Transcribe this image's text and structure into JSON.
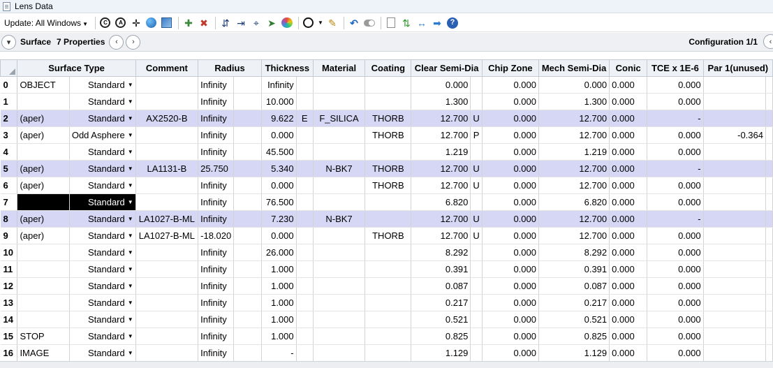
{
  "window": {
    "title": "Lens Data"
  },
  "toolbar": {
    "update_label": "Update: All Windows",
    "icons": [
      "recalc-icon",
      "autofocus-icon",
      "move-icon",
      "globe-icon",
      "tile-icon",
      "insert-surface-icon",
      "delete-surface-icon",
      "pickup-icon",
      "solve-icon",
      "tilt-icon",
      "fold-icon",
      "palette-icon",
      "aperture-ring-icon",
      "edit-icon",
      "undo-icon",
      "toggle-icon",
      "page-icon",
      "swap-icon",
      "expand-icon",
      "arrow-right-icon",
      "help-icon"
    ]
  },
  "surface_bar": {
    "label": "Surface",
    "properties": "7 Properties",
    "configuration": "Configuration 1/1"
  },
  "table": {
    "columns": [
      "Surface Type",
      "Comment",
      "Radius",
      "Thickness",
      "Material",
      "Coating",
      "Clear Semi-Dia",
      "Chip Zone",
      "Mech Semi-Dia",
      "Conic",
      "TCE x 1E-6",
      "Par 1(unused)"
    ],
    "rows": [
      {
        "num": "0",
        "name": "OBJECT",
        "type": "Standard",
        "comment": "",
        "radius": "Infinity",
        "rsolve": "",
        "thickness": "Infinity",
        "tsolve": "",
        "material": "",
        "coating": "",
        "clear": "0.000",
        "csolve": "",
        "chip": "0.000",
        "mech": "0.000",
        "conic": "0.000",
        "tce": "0.000",
        "par1": "",
        "hl": false,
        "black": false
      },
      {
        "num": "1",
        "name": "",
        "type": "Standard",
        "comment": "",
        "radius": "Infinity",
        "rsolve": "",
        "thickness": "10.000",
        "tsolve": "",
        "material": "",
        "coating": "",
        "clear": "1.300",
        "csolve": "",
        "chip": "0.000",
        "mech": "1.300",
        "conic": "0.000",
        "tce": "0.000",
        "par1": "",
        "hl": false,
        "black": false
      },
      {
        "num": "2",
        "name": "(aper)",
        "type": "Standard",
        "comment": "AX2520-B",
        "radius": "Infinity",
        "rsolve": "",
        "thickness": "9.622",
        "tsolve": "E",
        "material": "F_SILICA",
        "coating": "THORB",
        "clear": "12.700",
        "csolve": "U",
        "chip": "0.000",
        "mech": "12.700",
        "conic": "0.000",
        "tce": "-",
        "par1": "",
        "hl": true,
        "black": false
      },
      {
        "num": "3",
        "name": "(aper)",
        "type": "Odd Asphere",
        "comment": "",
        "radius": "Infinity",
        "rsolve": "",
        "thickness": "0.000",
        "tsolve": "",
        "material": "",
        "coating": "THORB",
        "clear": "12.700",
        "csolve": "P",
        "chip": "0.000",
        "mech": "12.700",
        "conic": "0.000",
        "tce": "0.000",
        "par1": "-0.364",
        "hl": false,
        "black": false
      },
      {
        "num": "4",
        "name": "",
        "type": "Standard",
        "comment": "",
        "radius": "Infinity",
        "rsolve": "",
        "thickness": "45.500",
        "tsolve": "",
        "material": "",
        "coating": "",
        "clear": "1.219",
        "csolve": "",
        "chip": "0.000",
        "mech": "1.219",
        "conic": "0.000",
        "tce": "0.000",
        "par1": "",
        "hl": false,
        "black": false
      },
      {
        "num": "5",
        "name": "(aper)",
        "type": "Standard",
        "comment": "LA1131-B",
        "radius": "25.750",
        "rsolve": "",
        "thickness": "5.340",
        "tsolve": "",
        "material": "N-BK7",
        "coating": "THORB",
        "clear": "12.700",
        "csolve": "U",
        "chip": "0.000",
        "mech": "12.700",
        "conic": "0.000",
        "tce": "-",
        "par1": "",
        "hl": true,
        "black": false
      },
      {
        "num": "6",
        "name": "(aper)",
        "type": "Standard",
        "comment": "",
        "radius": "Infinity",
        "rsolve": "",
        "thickness": "0.000",
        "tsolve": "",
        "material": "",
        "coating": "THORB",
        "clear": "12.700",
        "csolve": "U",
        "chip": "0.000",
        "mech": "12.700",
        "conic": "0.000",
        "tce": "0.000",
        "par1": "",
        "hl": false,
        "black": false
      },
      {
        "num": "7",
        "name": "",
        "type": "Standard",
        "comment": "",
        "radius": "Infinity",
        "rsolve": "",
        "thickness": "76.500",
        "tsolve": "",
        "material": "",
        "coating": "",
        "clear": "6.820",
        "csolve": "",
        "chip": "0.000",
        "mech": "6.820",
        "conic": "0.000",
        "tce": "0.000",
        "par1": "",
        "hl": false,
        "black": true
      },
      {
        "num": "8",
        "name": "(aper)",
        "type": "Standard",
        "comment": "LA1027-B-ML",
        "radius": "Infinity",
        "rsolve": "",
        "thickness": "7.230",
        "tsolve": "",
        "material": "N-BK7",
        "coating": "",
        "clear": "12.700",
        "csolve": "U",
        "chip": "0.000",
        "mech": "12.700",
        "conic": "0.000",
        "tce": "-",
        "par1": "",
        "hl": true,
        "black": false
      },
      {
        "num": "9",
        "name": "(aper)",
        "type": "Standard",
        "comment": "LA1027-B-ML",
        "radius": "-18.020",
        "rsolve": "",
        "thickness": "0.000",
        "tsolve": "",
        "material": "",
        "coating": "THORB",
        "clear": "12.700",
        "csolve": "U",
        "chip": "0.000",
        "mech": "12.700",
        "conic": "0.000",
        "tce": "0.000",
        "par1": "",
        "hl": false,
        "black": false
      },
      {
        "num": "10",
        "name": "",
        "type": "Standard",
        "comment": "",
        "radius": "Infinity",
        "rsolve": "",
        "thickness": "26.000",
        "tsolve": "",
        "material": "",
        "coating": "",
        "clear": "8.292",
        "csolve": "",
        "chip": "0.000",
        "mech": "8.292",
        "conic": "0.000",
        "tce": "0.000",
        "par1": "",
        "hl": false,
        "black": false
      },
      {
        "num": "11",
        "name": "",
        "type": "Standard",
        "comment": "",
        "radius": "Infinity",
        "rsolve": "",
        "thickness": "1.000",
        "tsolve": "",
        "material": "",
        "coating": "",
        "clear": "0.391",
        "csolve": "",
        "chip": "0.000",
        "mech": "0.391",
        "conic": "0.000",
        "tce": "0.000",
        "par1": "",
        "hl": false,
        "black": false
      },
      {
        "num": "12",
        "name": "",
        "type": "Standard",
        "comment": "",
        "radius": "Infinity",
        "rsolve": "",
        "thickness": "1.000",
        "tsolve": "",
        "material": "",
        "coating": "",
        "clear": "0.087",
        "csolve": "",
        "chip": "0.000",
        "mech": "0.087",
        "conic": "0.000",
        "tce": "0.000",
        "par1": "",
        "hl": false,
        "black": false
      },
      {
        "num": "13",
        "name": "",
        "type": "Standard",
        "comment": "",
        "radius": "Infinity",
        "rsolve": "",
        "thickness": "1.000",
        "tsolve": "",
        "material": "",
        "coating": "",
        "clear": "0.217",
        "csolve": "",
        "chip": "0.000",
        "mech": "0.217",
        "conic": "0.000",
        "tce": "0.000",
        "par1": "",
        "hl": false,
        "black": false
      },
      {
        "num": "14",
        "name": "",
        "type": "Standard",
        "comment": "",
        "radius": "Infinity",
        "rsolve": "",
        "thickness": "1.000",
        "tsolve": "",
        "material": "",
        "coating": "",
        "clear": "0.521",
        "csolve": "",
        "chip": "0.000",
        "mech": "0.521",
        "conic": "0.000",
        "tce": "0.000",
        "par1": "",
        "hl": false,
        "black": false
      },
      {
        "num": "15",
        "name": "STOP",
        "type": "Standard",
        "comment": "",
        "radius": "Infinity",
        "rsolve": "",
        "thickness": "1.000",
        "tsolve": "",
        "material": "",
        "coating": "",
        "clear": "0.825",
        "csolve": "",
        "chip": "0.000",
        "mech": "0.825",
        "conic": "0.000",
        "tce": "0.000",
        "par1": "",
        "hl": false,
        "black": false
      },
      {
        "num": "16",
        "name": "IMAGE",
        "type": "Standard",
        "comment": "",
        "radius": "Infinity",
        "rsolve": "",
        "thickness": "-",
        "tsolve": "",
        "material": "",
        "coating": "",
        "clear": "1.129",
        "csolve": "",
        "chip": "0.000",
        "mech": "1.129",
        "conic": "0.000",
        "tce": "0.000",
        "par1": "",
        "hl": false,
        "black": false
      }
    ]
  }
}
